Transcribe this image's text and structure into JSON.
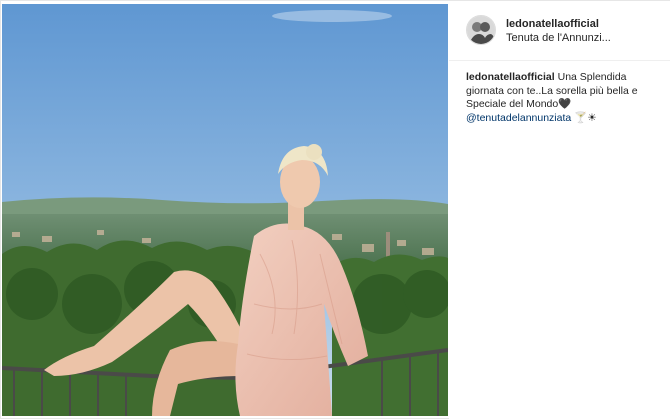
{
  "post": {
    "username": "ledonatellaofficial",
    "location": "Tenuta de l'Annunzi...",
    "caption_user": "ledonatellaofficial",
    "caption_text": "Una Splendida giornata con te..La sorella più bella e Speciale del Mondo🖤",
    "mention": "@tenutadelannunziata",
    "caption_emoji": "🍸☀"
  },
  "icons": {
    "avatar": "profile-avatar-icon"
  }
}
